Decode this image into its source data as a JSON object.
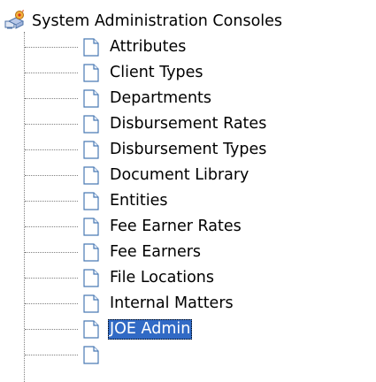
{
  "tree": {
    "root": {
      "label": "System Administration Consoles",
      "icon": "admin-console-folder-icon",
      "expanded": true
    },
    "items": [
      {
        "label": "Attributes",
        "icon": "document-icon",
        "selected": false
      },
      {
        "label": "Client Types",
        "icon": "document-icon",
        "selected": false
      },
      {
        "label": "Departments",
        "icon": "document-icon",
        "selected": false
      },
      {
        "label": "Disbursement Rates",
        "icon": "document-icon",
        "selected": false
      },
      {
        "label": "Disbursement Types",
        "icon": "document-icon",
        "selected": false
      },
      {
        "label": "Document Library",
        "icon": "document-icon",
        "selected": false
      },
      {
        "label": "Entities",
        "icon": "document-icon",
        "selected": false
      },
      {
        "label": "Fee Earner Rates",
        "icon": "document-icon",
        "selected": false
      },
      {
        "label": "Fee Earners",
        "icon": "document-icon",
        "selected": false
      },
      {
        "label": "File Locations",
        "icon": "document-icon",
        "selected": false
      },
      {
        "label": "Internal Matters",
        "icon": "document-icon",
        "selected": false
      },
      {
        "label": "JOE Admin",
        "icon": "document-icon",
        "selected": true
      },
      {
        "label": "",
        "icon": "document-icon",
        "selected": false
      }
    ]
  },
  "colors": {
    "selection_bg": "#316ac5",
    "selection_fg": "#ffffff",
    "tree_lines": "#808080",
    "doc_icon_blue": "#4a7ab5"
  }
}
